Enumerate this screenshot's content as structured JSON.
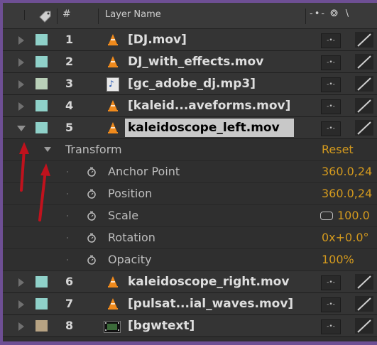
{
  "header": {
    "hash": "#",
    "layer_name": "Layer Name",
    "switch_icons": "-•- ❂ ∖"
  },
  "layers_top": [
    {
      "num": "1",
      "name": "[DJ.mov]",
      "swatch": "#8fd1c9",
      "icon": "vlc-cone-icon"
    },
    {
      "num": "2",
      "name": "DJ_with_effects.mov",
      "swatch": "#8fd1c9",
      "icon": "vlc-cone-icon"
    },
    {
      "num": "3",
      "name": "[gc_adobe_dj.mp3]",
      "swatch": "#b9d0b8",
      "icon": "audio-file-icon"
    },
    {
      "num": "4",
      "name": "[kaleid...aveforms.mov]",
      "swatch": "#8fd1c9",
      "icon": "vlc-cone-icon"
    },
    {
      "num": "5",
      "name": "kaleidoscope_left.mov",
      "swatch": "#8fd1c9",
      "icon": "vlc-cone-icon",
      "selected": true
    }
  ],
  "transform": {
    "label": "Transform",
    "reset": "Reset",
    "properties": [
      {
        "label": "Anchor Point",
        "value": "360.0,24"
      },
      {
        "label": "Position",
        "value": "360.0,24"
      },
      {
        "label": "Scale",
        "value": "100.0"
      },
      {
        "label": "Rotation",
        "value": "0x+0.0°"
      },
      {
        "label": "Opacity",
        "value": "100%"
      }
    ]
  },
  "layers_bottom": [
    {
      "num": "6",
      "name": "kaleidoscope_right.mov",
      "swatch": "#8fd1c9",
      "icon": "vlc-cone-icon"
    },
    {
      "num": "7",
      "name": "[pulsat...ial_waves.mov]",
      "swatch": "#8fd1c9",
      "icon": "vlc-cone-icon"
    },
    {
      "num": "8",
      "name": "[bgwtext]",
      "swatch": "#b7a383",
      "icon": "film-comp-icon"
    }
  ],
  "colors": {
    "value_orange": "#d49a1e",
    "annotation_red": "#c0121d",
    "frame_purple": "#6e4f94"
  }
}
